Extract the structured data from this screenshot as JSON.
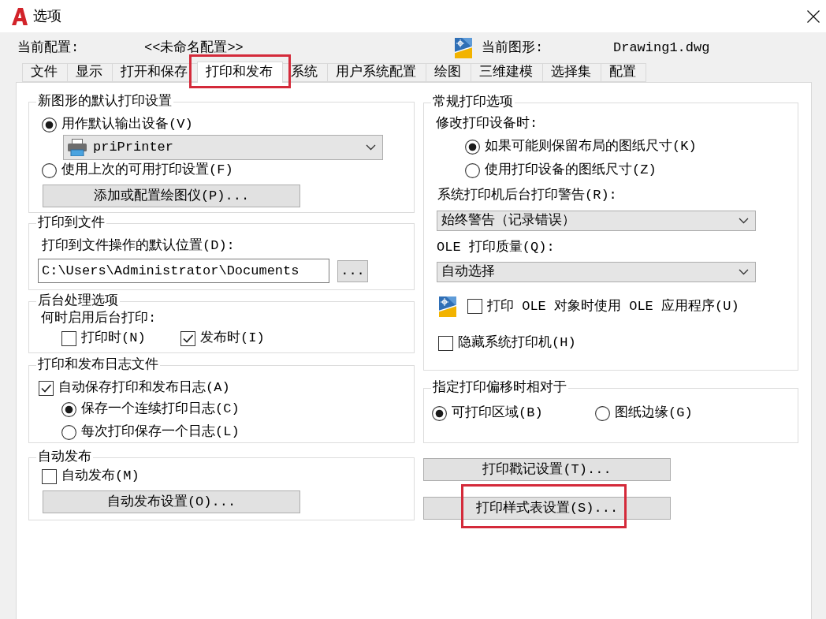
{
  "window": {
    "title": "选项"
  },
  "current_profile": {
    "label": "当前配置:",
    "value": "<<未命名配置>>"
  },
  "current_drawing": {
    "label": "当前图形:",
    "value": "Drawing1.dwg"
  },
  "tabs": [
    {
      "label": "文件",
      "selected": false,
      "highlighted": false
    },
    {
      "label": "显示",
      "selected": false,
      "highlighted": false
    },
    {
      "label": "打开和保存",
      "selected": false,
      "highlighted": false
    },
    {
      "label": "打印和发布",
      "selected": true,
      "highlighted": true
    },
    {
      "label": "系统",
      "selected": false,
      "highlighted": false
    },
    {
      "label": "用户系统配置",
      "selected": false,
      "highlighted": false
    },
    {
      "label": "绘图",
      "selected": false,
      "highlighted": false
    },
    {
      "label": "三维建模",
      "selected": false,
      "highlighted": false
    },
    {
      "label": "选择集",
      "selected": false,
      "highlighted": false
    },
    {
      "label": "配置",
      "selected": false,
      "highlighted": false
    }
  ],
  "default_plot_settings": {
    "title": "新图形的默认打印设置",
    "options": [
      {
        "label": "用作默认输出设备(V)",
        "selected": true
      },
      {
        "label": "使用上次的可用打印设置(F)",
        "selected": false
      }
    ],
    "device": {
      "value": "priPrinter"
    },
    "button": "添加或配置绘图仪(P)..."
  },
  "plot_to_file": {
    "title": "打印到文件",
    "label": "打印到文件操作的默认位置(D):",
    "value": "C:\\Users\\Administrator\\Documents",
    "browse_button": "..."
  },
  "background_processing": {
    "title": "后台处理选项",
    "label": "何时启用后台打印:",
    "options": [
      {
        "label": "打印时(N)",
        "checked": false
      },
      {
        "label": "发布时(I)",
        "checked": true
      }
    ]
  },
  "log_file": {
    "title": "打印和发布日志文件",
    "auto_save": {
      "label": "自动保存打印和发布日志(A)",
      "checked": true
    },
    "options": [
      {
        "label": "保存一个连续打印日志(C)",
        "selected": true
      },
      {
        "label": "每次打印保存一个日志(L)",
        "selected": false
      }
    ]
  },
  "auto_publish": {
    "title": "自动发布",
    "checkbox": {
      "label": "自动发布(M)",
      "checked": false
    },
    "button": "自动发布设置(O)..."
  },
  "general_options": {
    "title": "常规打印选项",
    "device_change_label": "修改打印设备时:",
    "paper_options": [
      {
        "label": "如果可能则保留布局的图纸尺寸(K)",
        "selected": true
      },
      {
        "label": "使用打印设备的图纸尺寸(Z)",
        "selected": false
      }
    ],
    "spool_alert": {
      "label": "系统打印机后台打印警告(R):",
      "value": "始终警告（记录错误）"
    },
    "ole_quality": {
      "label": "OLE 打印质量(Q):",
      "value": "自动选择"
    },
    "use_ole_app": {
      "label": "打印 OLE 对象时使用 OLE 应用程序(U)",
      "checked": false
    },
    "hide_system_printers": {
      "label": "隐藏系统打印机(H)",
      "checked": false
    }
  },
  "plot_offset": {
    "title": "指定打印偏移时相对于",
    "options": [
      {
        "label": "可打印区域(B)",
        "selected": true
      },
      {
        "label": "图纸边缘(G)",
        "selected": false
      }
    ]
  },
  "buttons": [
    {
      "label": "打印戳记设置(T)...",
      "highlighted": false
    },
    {
      "label": "打印样式表设置(S)...",
      "highlighted": true
    }
  ]
}
